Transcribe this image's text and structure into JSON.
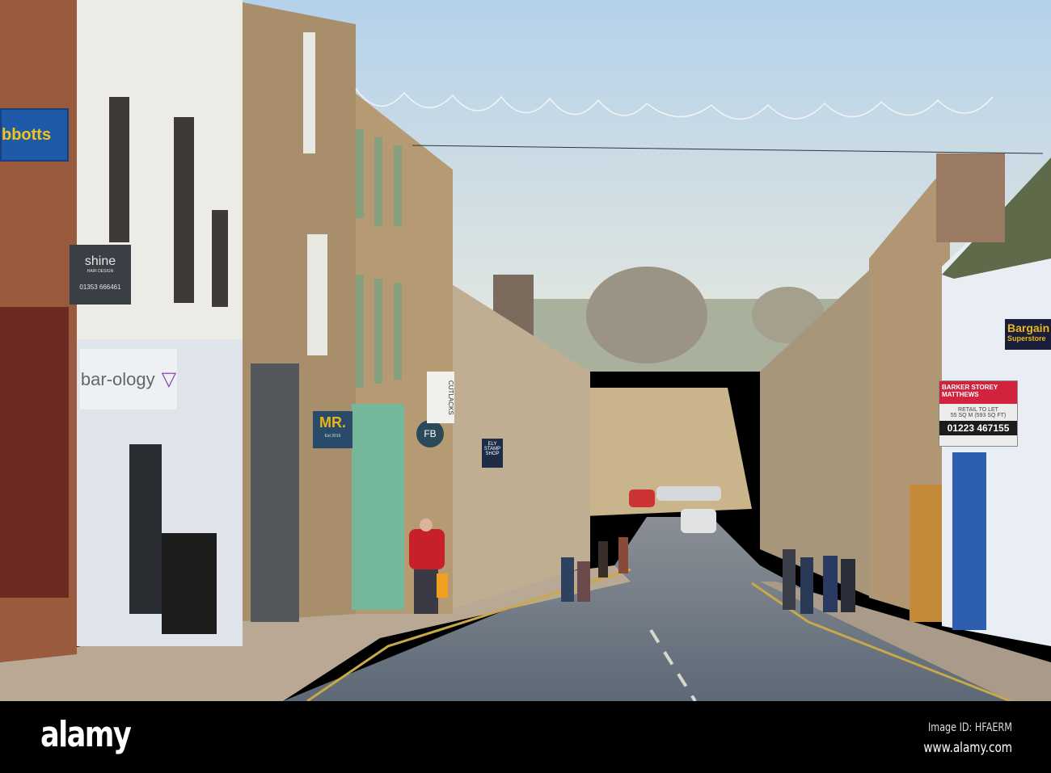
{
  "signs": {
    "abbotts": "bbotts",
    "shine": "shine",
    "shine_sub": "HAIR DESIGN",
    "shine_phone": "01353 666461",
    "barology": "bar-ology",
    "mr": "MR.",
    "mr_est": "Est 2016",
    "fb": "FB",
    "cutlacks": "CUTLACKS",
    "ely_stamp": "ELY STAMP SHOP",
    "bargain": "Bargain",
    "superstore": "Superstore",
    "agent_name_1": "BARKER STOREY",
    "agent_name_2": "MATTHEWS",
    "retail": "RETAIL TO LET",
    "size": "55 SQ M (593 SQ FT)",
    "phone": "01223 467155"
  },
  "watermark": {
    "logo": "alamy",
    "image_id": "Image ID: HFAERM",
    "site": "www.alamy.com"
  },
  "colors": {
    "sky_top": "#b6d2ea",
    "sky_bottom": "#e2e6e0",
    "road": "#6f7a86",
    "band": "#000000"
  }
}
